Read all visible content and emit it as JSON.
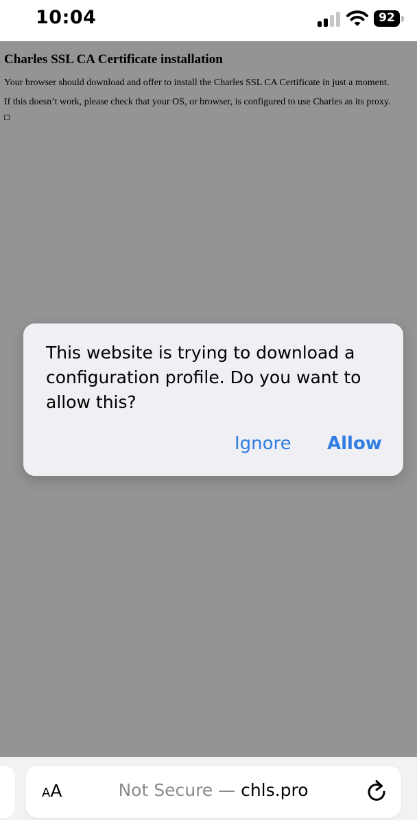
{
  "status_bar": {
    "time": "10:04",
    "battery": "92",
    "icons": [
      "cellular-signal-icon",
      "wifi-icon",
      "battery-icon"
    ]
  },
  "webpage": {
    "title": "Charles SSL CA Certificate installation",
    "paragraph1": "Your browser should download and offer to install the Charles SSL CA Certificate in just a moment.",
    "paragraph2": "If this doesn’t work, please check that your OS, or browser, is configured to use Charles as its proxy."
  },
  "alert": {
    "message": "This website is trying to download a configuration profile. Do you want to allow this?",
    "ignore_label": "Ignore",
    "allow_label": "Allow"
  },
  "address_bar": {
    "reader_small": "A",
    "reader_big": "A",
    "security_status": "Not Secure",
    "separator": " — ",
    "domain": "chls.pro",
    "reload_icon": "reload-icon"
  },
  "colors": {
    "accent": "#2f7de1",
    "overlay": "#959595",
    "alert_background": "#efeff4"
  }
}
